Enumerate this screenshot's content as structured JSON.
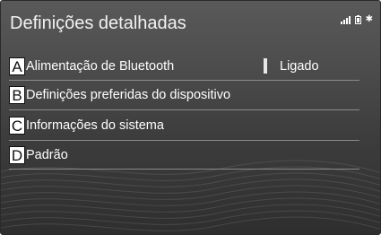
{
  "header": {
    "title": "Definições detalhadas",
    "status_icons": [
      "signal-icon",
      "battery-icon",
      "bluetooth-icon"
    ],
    "bluetooth_glyph": "✱"
  },
  "menu": {
    "items": [
      {
        "letter": "A",
        "label": "Alimentação de Bluetooth",
        "value": "Ligado"
      },
      {
        "letter": "B",
        "label": "Definições preferidas do dispositivo"
      },
      {
        "letter": "C",
        "label": "Informações do sistema"
      },
      {
        "letter": "D",
        "label": "Padrão"
      }
    ]
  },
  "colors": {
    "background_top": "#595959",
    "background_bottom": "#2e2e2e",
    "text": "#ffffff",
    "divider": "#8a8a8a"
  }
}
